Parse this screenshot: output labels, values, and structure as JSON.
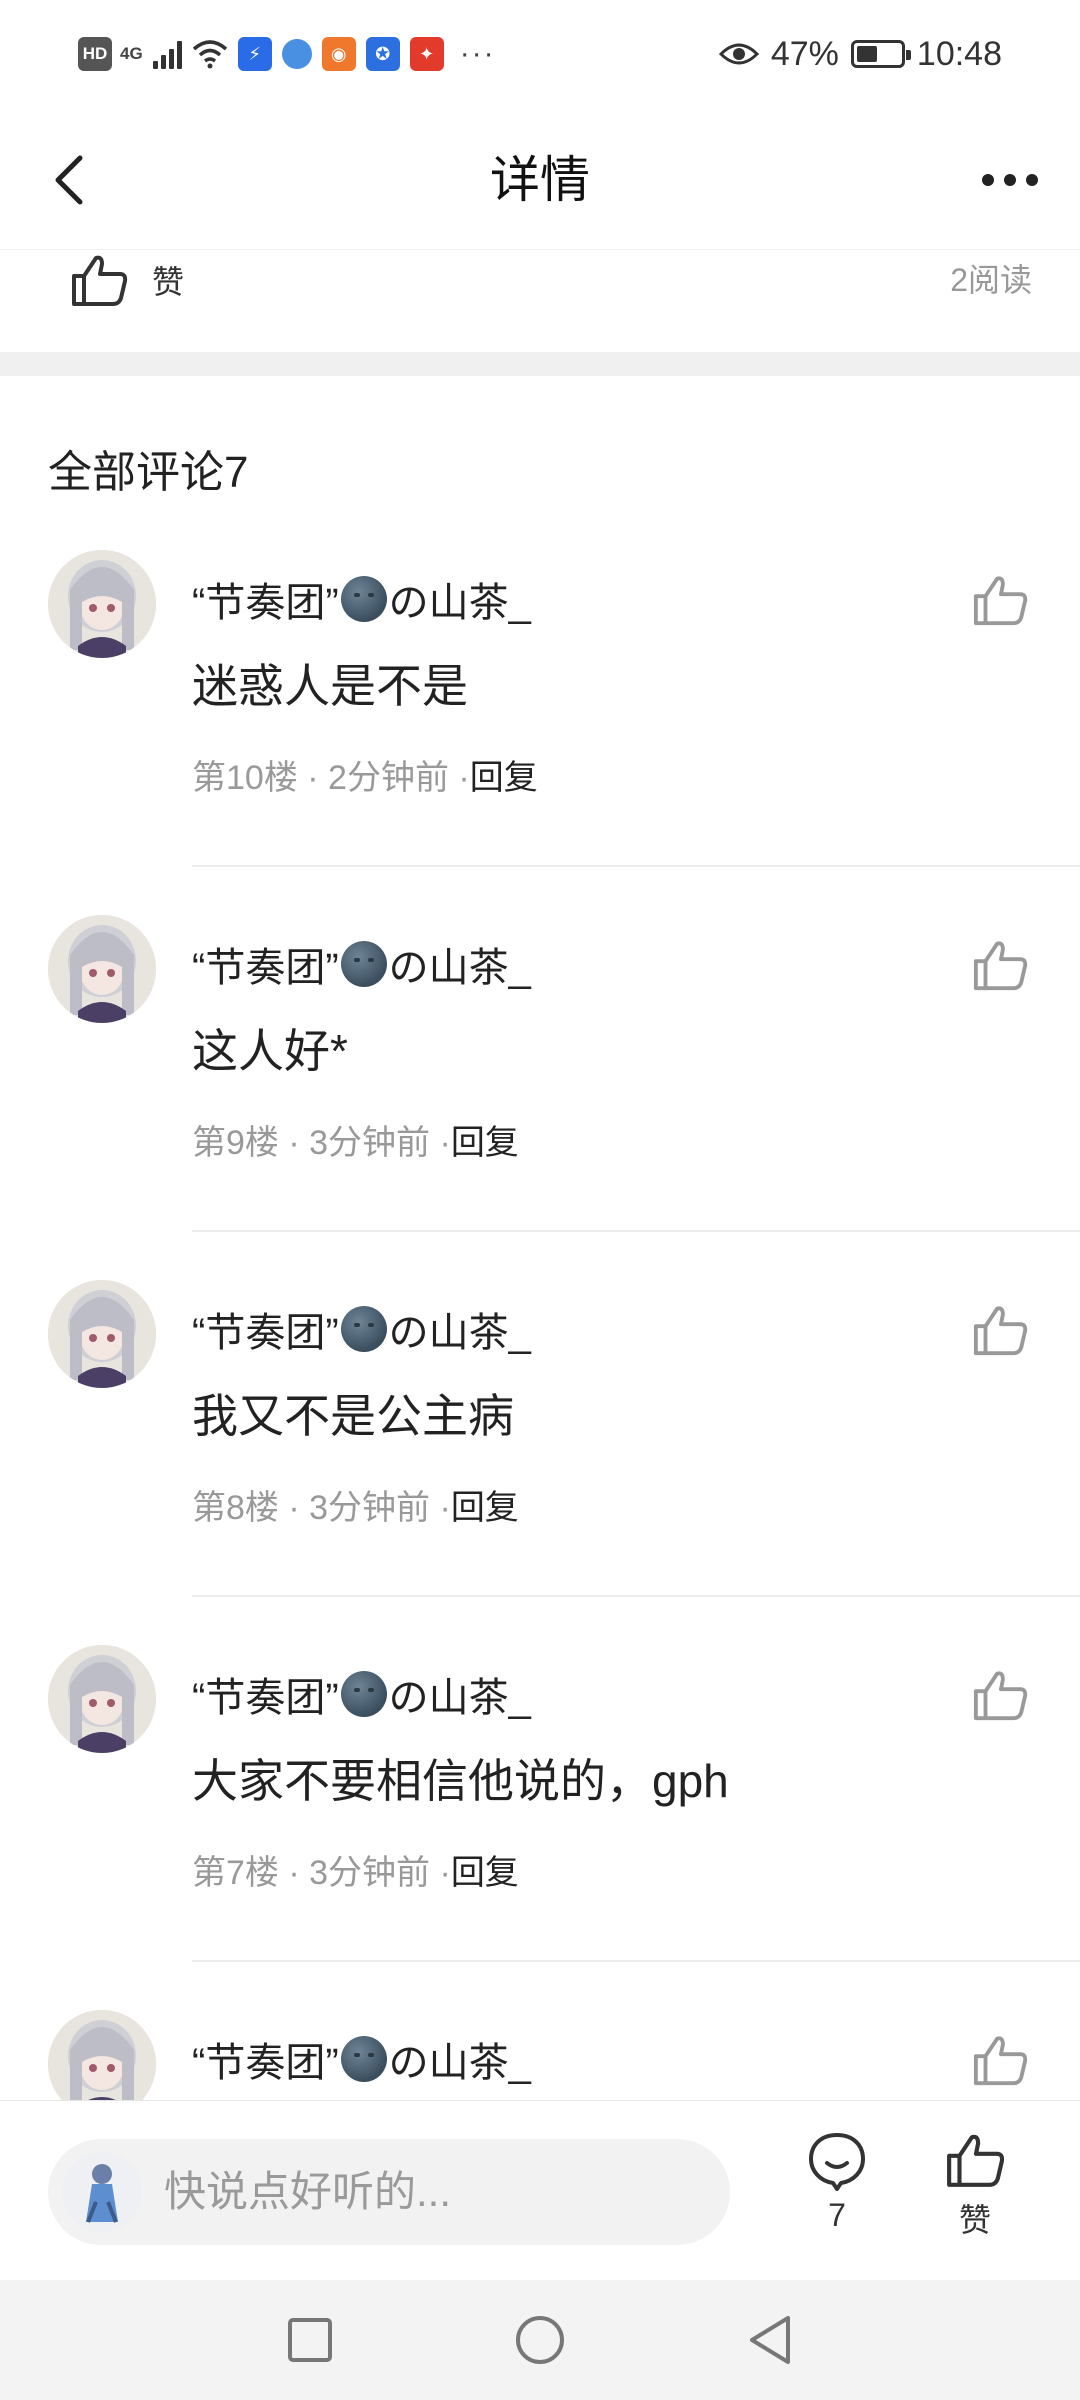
{
  "status_bar": {
    "left_badges": [
      "HD",
      "4G"
    ],
    "more": "···",
    "battery_percent": "47%",
    "battery_level": 0.47,
    "time": "10:48"
  },
  "header": {
    "title": "详情"
  },
  "post_stats": {
    "like_label": "赞",
    "reads": "2阅读"
  },
  "comments_section": {
    "title": "全部评论7",
    "items": [
      {
        "name_prefix": "“节奏团”",
        "name_suffix": "の山茶_",
        "text": "迷惑人是不是",
        "meta": "第10楼 · 2分钟前 ·",
        "reply": "回复"
      },
      {
        "name_prefix": "“节奏团”",
        "name_suffix": "の山茶_",
        "text": "这人好*",
        "meta": "第9楼 · 3分钟前 ·",
        "reply": "回复"
      },
      {
        "name_prefix": "“节奏团”",
        "name_suffix": "の山茶_",
        "text": "我又不是公主病",
        "meta": "第8楼 · 3分钟前 ·",
        "reply": "回复"
      },
      {
        "name_prefix": "“节奏团”",
        "name_suffix": "の山茶_",
        "text": "大家不要相信他说的，gph",
        "meta": "第7楼 · 3分钟前 ·",
        "reply": "回复"
      },
      {
        "name_prefix": "“节奏团”",
        "name_suffix": "の山茶_"
      }
    ]
  },
  "bottom_bar": {
    "placeholder": "快说点好听的...",
    "comment_count": "7",
    "like_label": "赞"
  }
}
